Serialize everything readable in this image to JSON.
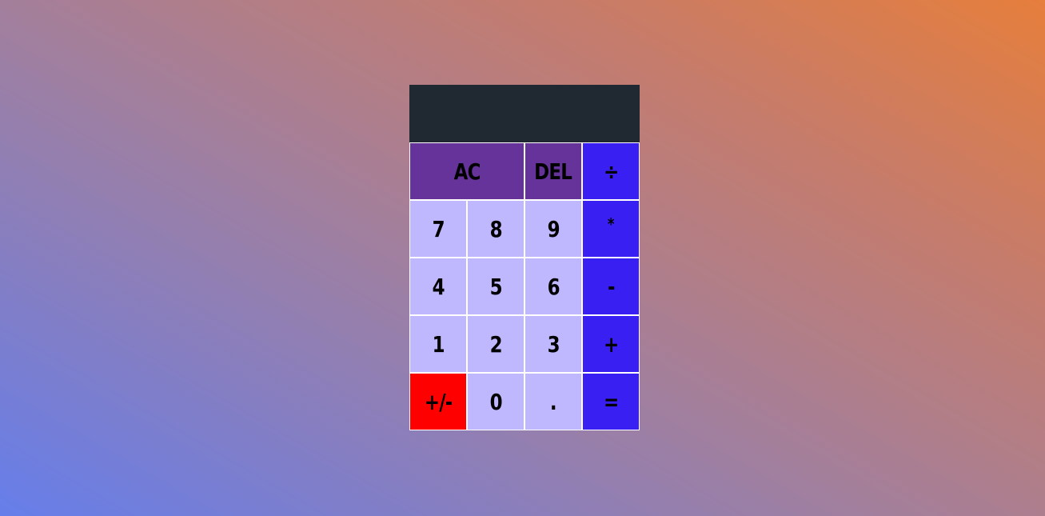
{
  "display": {
    "previous_operand": "",
    "current_operand": ""
  },
  "buttons": {
    "ac": "AC",
    "del": "DEL",
    "divide": "÷",
    "seven": "7",
    "eight": "8",
    "nine": "9",
    "multiply": "*",
    "four": "4",
    "five": "5",
    "six": "6",
    "subtract": "-",
    "one": "1",
    "two": "2",
    "three": "3",
    "add": "+",
    "negate": "+/-",
    "zero": "0",
    "decimal": ".",
    "equals": "="
  },
  "colors": {
    "display_bg": "#202831",
    "digit_bg": "#c0b8ff",
    "control_bg": "#66339a",
    "operator_bg": "#3a1ff2",
    "negate_bg": "#ff0000",
    "gradient_start": "#667eea",
    "gradient_end": "#e67e3c"
  }
}
